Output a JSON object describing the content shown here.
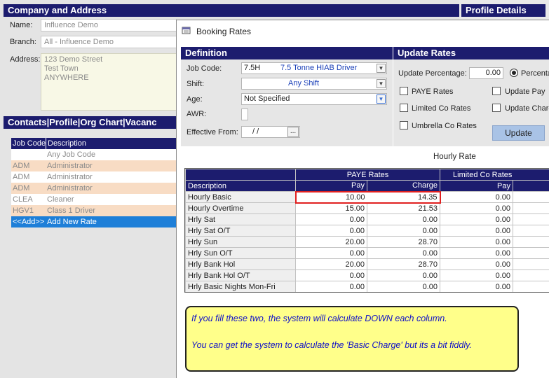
{
  "company": {
    "header": "Company and Address",
    "profile_header": "Profile Details",
    "name_label": "Name:",
    "name_value": "Influence Demo",
    "branch_label": "Branch:",
    "branch_value": "All - Influence Demo",
    "address_label": "Address:",
    "address_lines": [
      "123 Demo Street",
      "Test Town",
      "ANYWHERE"
    ]
  },
  "contacts_tabs": "Contacts|Profile|Org Chart|Vacanc",
  "job_list": {
    "headers": [
      "Job Code",
      "Description"
    ],
    "rows": [
      {
        "code": "",
        "desc": "Any Job Code"
      },
      {
        "code": "ADM",
        "desc": "Administrator"
      },
      {
        "code": "ADM",
        "desc": "Administrator"
      },
      {
        "code": "ADM",
        "desc": "Administrator"
      },
      {
        "code": "CLEA",
        "desc": "Cleaner"
      },
      {
        "code": "HGV1",
        "desc": "Class 1 Driver"
      },
      {
        "code": "<<Add>>",
        "desc": "Add New Rate"
      }
    ]
  },
  "dialog": {
    "title": "Booking Rates",
    "definition": {
      "header": "Definition",
      "job_code_label": "Job Code:",
      "job_code_value": "7.5H",
      "job_code_desc": "7.5 Tonne HIAB Driver",
      "shift_label": "Shift:",
      "shift_value": "Any Shift",
      "age_label": "Age:",
      "age_value": "Not Specified",
      "awr_label": "AWR:",
      "effective_label": "Effective From:",
      "effective_value": "/   /",
      "ellipsis": "..."
    },
    "update": {
      "header": "Update Rates",
      "percentage_label": "Update Percentage:",
      "percentage_value": "0.00",
      "percent_radio": "Percenta",
      "paye_label": "PAYE Rates",
      "ltd_label": "Limited Co Rates",
      "umbrella_label": "Umbrella Co Rates",
      "update_pay_label": "Update Pay",
      "update_charge_label": "Update Charg",
      "update_button": "Update"
    },
    "rate_type": "Hourly Rate",
    "table": {
      "group_paye": "PAYE Rates",
      "group_ltd": "Limited Co Rates",
      "col_desc": "Description",
      "col_pay": "Pay",
      "col_charge": "Charge",
      "col_ltd_pay": "Pay",
      "rows": [
        {
          "desc": "Hourly Basic",
          "pay": "10.00",
          "charge": "14.35",
          "ltd_pay": "0.00"
        },
        {
          "desc": "Hourly Overtime",
          "pay": "15.00",
          "charge": "21.53",
          "ltd_pay": "0.00"
        },
        {
          "desc": "Hrly Sat",
          "pay": "0.00",
          "charge": "0.00",
          "ltd_pay": "0.00"
        },
        {
          "desc": "Hrly Sat O/T",
          "pay": "0.00",
          "charge": "0.00",
          "ltd_pay": "0.00"
        },
        {
          "desc": "Hrly Sun",
          "pay": "20.00",
          "charge": "28.70",
          "ltd_pay": "0.00"
        },
        {
          "desc": "Hrly Sun O/T",
          "pay": "0.00",
          "charge": "0.00",
          "ltd_pay": "0.00"
        },
        {
          "desc": "Hrly Bank Hol",
          "pay": "20.00",
          "charge": "28.70",
          "ltd_pay": "0.00"
        },
        {
          "desc": "Hrly Bank Hol O/T",
          "pay": "0.00",
          "charge": "0.00",
          "ltd_pay": "0.00"
        },
        {
          "desc": "Hrly Basic Nights Mon-Fri",
          "pay": "0.00",
          "charge": "0.00",
          "ltd_pay": "0.00"
        }
      ]
    }
  },
  "note": {
    "line1": "If you fill these two, the system will calculate DOWN each column.",
    "line2": "You can get the system to calculate the 'Basic Charge' but its a bit fiddly."
  },
  "colors": {
    "header_navy": "#1c1c6e",
    "highlight_red": "#e02020",
    "selected_blue": "#1e7fd8",
    "row_peach": "#f8dcc4",
    "note_yellow": "#ffff8a"
  }
}
